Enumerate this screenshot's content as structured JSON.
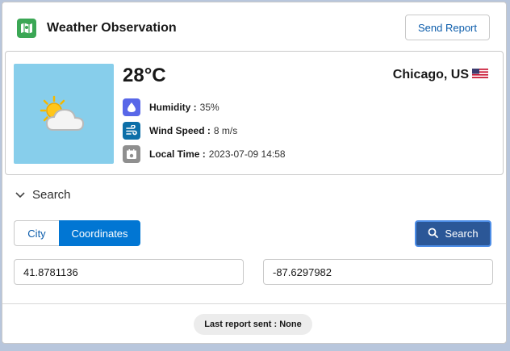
{
  "header": {
    "title": "Weather Observation",
    "app_icon": "map-icon",
    "send_report_label": "Send Report"
  },
  "weather": {
    "condition_icon": "partly-cloudy-icon",
    "temperature": "28°C",
    "location": "Chicago, US",
    "flag_icon": "us-flag-icon",
    "humidity_label": "Humidity :",
    "humidity_value": "35%",
    "wind_label": "Wind Speed :",
    "wind_value": "8 m/s",
    "time_label": "Local Time :",
    "time_value": "2023-07-09 14:58"
  },
  "search": {
    "section_label": "Search",
    "mode_city": "City",
    "mode_coordinates": "Coordinates",
    "selected_mode": "Coordinates",
    "button_label": "Search",
    "latitude": "41.8781136",
    "longitude": "-87.6297982"
  },
  "footer": {
    "status_text": "Last report sent : None"
  },
  "colors": {
    "brand": "#0176d3",
    "search_button": "#2b5797",
    "app_icon": "#3ba755",
    "humidity_icon": "#5867e8",
    "wind_icon": "#0d6fa8",
    "time_icon": "#8f8f8f",
    "weather_bg": "#87ceeb"
  }
}
